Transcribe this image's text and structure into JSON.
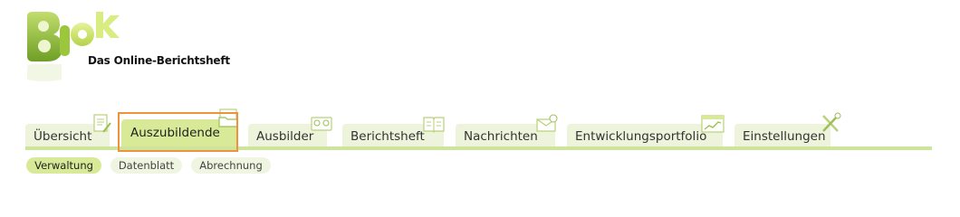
{
  "logo": {
    "subtitle": "Das Online-Berichtsheft"
  },
  "tabs": [
    {
      "label": "Übersicht",
      "icon": "clipboard-pen-icon",
      "active": false
    },
    {
      "label": "Auszubildende",
      "icon": "folder-icon",
      "active": true
    },
    {
      "label": "Ausbilder",
      "icon": "id-card-icon",
      "active": false
    },
    {
      "label": "Berichtsheft",
      "icon": "open-book-icon",
      "active": false
    },
    {
      "label": "Nachrichten",
      "icon": "envelope-icon",
      "active": false
    },
    {
      "label": "Entwicklungsportfolio",
      "icon": "chart-window-icon",
      "active": false
    },
    {
      "label": "Einstellungen",
      "icon": "tools-icon",
      "active": false
    }
  ],
  "subtabs": [
    {
      "label": "Verwaltung",
      "active": true
    },
    {
      "label": "Datenblatt",
      "active": false
    },
    {
      "label": "Abrechnung",
      "active": false
    }
  ],
  "colors": {
    "tab_active": "#d8ea97",
    "tab_inactive": "#eef4dc",
    "tab_line": "#cde49a",
    "highlight_outline": "#f0913c",
    "logo_green": "#8dbb3c"
  }
}
